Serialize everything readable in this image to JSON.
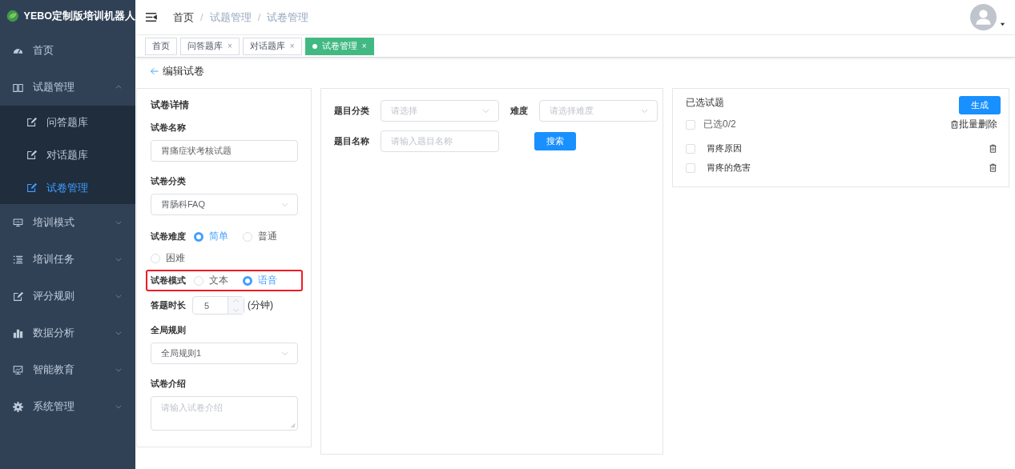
{
  "app": {
    "title": "YEBO定制版培训机器人"
  },
  "sidebar": {
    "items": [
      {
        "label": "首页"
      },
      {
        "label": "试题管理",
        "expanded": true,
        "children": [
          {
            "label": "问答题库",
            "selected": false
          },
          {
            "label": "对话题库",
            "selected": false
          },
          {
            "label": "试卷管理",
            "selected": true
          }
        ]
      },
      {
        "label": "培训模式",
        "expanded": false
      },
      {
        "label": "培训任务",
        "expanded": false
      },
      {
        "label": "评分规则",
        "expanded": false
      },
      {
        "label": "数据分析",
        "expanded": false
      },
      {
        "label": "智能教育",
        "expanded": false
      },
      {
        "label": "系统管理",
        "expanded": false
      }
    ]
  },
  "breadcrumb": [
    {
      "label": "首页"
    },
    {
      "separator": "/",
      "label": "试题管理"
    },
    {
      "separator": "/",
      "label": "试卷管理"
    }
  ],
  "tags": [
    {
      "label": "首页",
      "selected": false
    },
    {
      "label": "问答题库",
      "selected": false,
      "close": "×"
    },
    {
      "label": "对话题库",
      "selected": false,
      "close": "×"
    },
    {
      "label": "试卷管理",
      "selected": true,
      "close": "×"
    }
  ],
  "back": {
    "label": "编辑试卷"
  },
  "paper_form": {
    "title": "试卷详情",
    "name": {
      "label": "试卷名称",
      "value": "胃痛症状考核试题"
    },
    "category": {
      "label": "试卷分类",
      "value": "胃肠科FAQ"
    },
    "difficulty": {
      "label": "试卷难度",
      "options": [
        {
          "label": "简单",
          "selected": true
        },
        {
          "label": "普通",
          "selected": false
        },
        {
          "label": "困难",
          "selected": false
        }
      ]
    },
    "mode": {
      "label": "试卷模式",
      "highlighted": true,
      "options": [
        {
          "label": "文本",
          "selected": false
        },
        {
          "label": "语音",
          "selected": true
        }
      ]
    },
    "duration": {
      "label": "答题时长",
      "value": "5",
      "unit": "(分钟)"
    },
    "rule": {
      "label": "全局规则",
      "value": "全局规则1"
    },
    "intro": {
      "label": "试卷介绍",
      "placeholder": "请输入试卷介绍"
    }
  },
  "search": {
    "category": {
      "label": "题目分类",
      "placeholder": "请选择"
    },
    "difficulty": {
      "label": "难度",
      "placeholder": "请选择难度"
    },
    "name": {
      "label": "题目名称",
      "placeholder": "请输入题目名称"
    },
    "button": "搜索"
  },
  "selected_panel": {
    "title": "已选试题",
    "generate": "生成",
    "select_all": {
      "label": "已选0/2",
      "checked": false
    },
    "batch_delete": "批量删除",
    "items": [
      {
        "label": "胃疼原因",
        "checked": false
      },
      {
        "label": "胃疼的危害",
        "checked": false
      }
    ]
  }
}
